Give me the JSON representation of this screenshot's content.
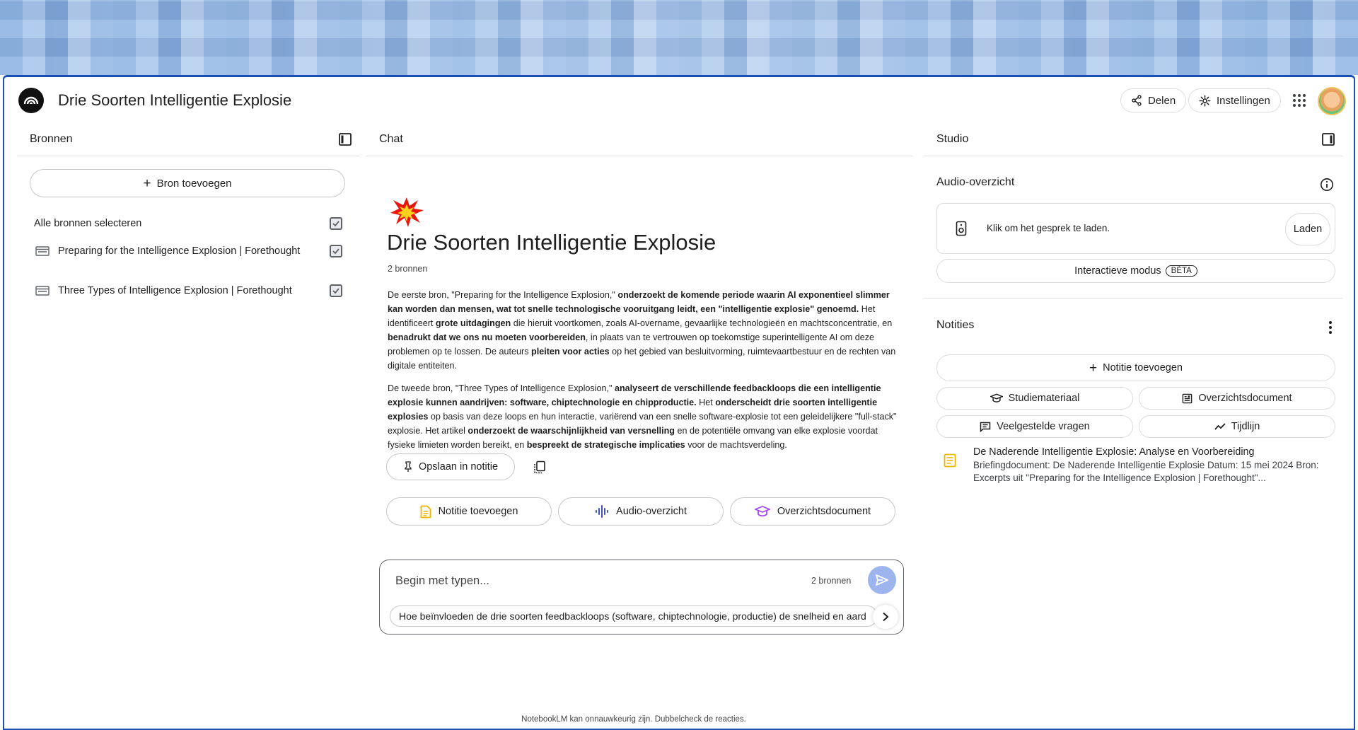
{
  "header": {
    "title": "Drie Soorten Intelligentie Explosie",
    "share_label": "Delen",
    "settings_label": "Instellingen"
  },
  "sources": {
    "panel_title": "Bronnen",
    "add_label": "Bron toevoegen",
    "select_all": "Alle bronnen selecteren",
    "items": [
      {
        "title": "Preparing for the Intelligence Explosion | Forethought"
      },
      {
        "title": "Three Types of Intelligence Explosion | Forethought"
      }
    ]
  },
  "chat": {
    "panel_title": "Chat",
    "title": "Drie Soorten Intelligentie Explosie",
    "source_count": "2 bronnen",
    "p1": [
      {
        "t": "De eerste bron, \"Preparing for the Intelligence Explosion,\" ",
        "b": false
      },
      {
        "t": "onderzoekt de komende periode waarin AI exponentieel slimmer kan worden dan mensen, wat tot snelle technologische vooruitgang leidt, een \"intelligentie explosie\" genoemd.",
        "b": true
      },
      {
        "t": " Het identificeert ",
        "b": false
      },
      {
        "t": "grote uitdagingen",
        "b": true
      },
      {
        "t": " die hieruit voortkomen, zoals AI-overname, gevaarlijke technologieën en machtsconcentratie, en ",
        "b": false
      },
      {
        "t": "benadrukt dat we ons nu moeten voorbereiden",
        "b": true
      },
      {
        "t": ", in plaats van te vertrouwen op toekomstige superintelligente AI om deze problemen op te lossen. De auteurs ",
        "b": false
      },
      {
        "t": "pleiten voor acties",
        "b": true
      },
      {
        "t": " op het gebied van besluitvorming, ruimtevaartbestuur en de rechten van digitale entiteiten.",
        "b": false
      }
    ],
    "p2": [
      {
        "t": "De tweede bron, \"Three Types of Intelligence Explosion,\" ",
        "b": false
      },
      {
        "t": "analyseert de verschillende feedbackloops die een intelligentie explosie kunnen aandrijven: software, chiptechnologie en chipproductie.",
        "b": true
      },
      {
        "t": " Het ",
        "b": false
      },
      {
        "t": "onderscheidt drie soorten intelligentie explosies",
        "b": true
      },
      {
        "t": " op basis van deze loops en hun interactie, variërend van een snelle software-explosie tot een geleidelijkere \"full-stack\" explosie. Het artikel ",
        "b": false
      },
      {
        "t": "onderzoekt de waarschijnlijkheid van versnelling",
        "b": true
      },
      {
        "t": " en de potentiële omvang van elke explosie voordat fysieke limieten worden bereikt, en ",
        "b": false
      },
      {
        "t": "bespreekt de strategische implicaties",
        "b": true
      },
      {
        "t": " voor de machtsverdeling.",
        "b": false
      }
    ],
    "save_note_label": "Opslaan in notitie",
    "chips": {
      "add_note": "Notitie toevoegen",
      "audio": "Audio-overzicht",
      "overview": "Overzichtsdocument"
    },
    "composer": {
      "placeholder": "Begin met typen...",
      "count": "2 bronnen",
      "suggestion": "Hoe beïnvloeden de drie soorten feedbackloops (software, chiptechnologie, productie) de snelheid en aard"
    },
    "disclaimer": "NotebookLM kan onnauwkeurig zijn. Dubbelcheck de reacties."
  },
  "studio": {
    "panel_title": "Studio",
    "audio_title": "Audio-overzicht",
    "audio_prompt": "Klik om het gesprek te laden.",
    "load_label": "Laden",
    "interactive_label": "Interactieve modus",
    "beta_label": "BÈTA",
    "notes_title": "Notities",
    "add_note_label": "Notitie toevoegen",
    "tools": {
      "study": "Studiemateriaal",
      "overview": "Overzichtsdocument",
      "faq": "Veelgestelde vragen",
      "timeline": "Tijdlijn"
    },
    "note": {
      "title": "De Naderende Intelligentie Explosie: Analyse en Voorbereiding",
      "body": "Briefingdocument: De Naderende Intelligentie Explosie Datum: 15 mei 2024 Bron: Excerpts uit \"Preparing for the Intelligence Explosion | Forethought\"..."
    }
  },
  "colors": {
    "accent_blue": "#1a4fb3",
    "send_button": "#9db4ef",
    "note_orange": "#f4b400",
    "audio_purple": "#3f51b5",
    "overview_magenta": "#a142f4"
  }
}
